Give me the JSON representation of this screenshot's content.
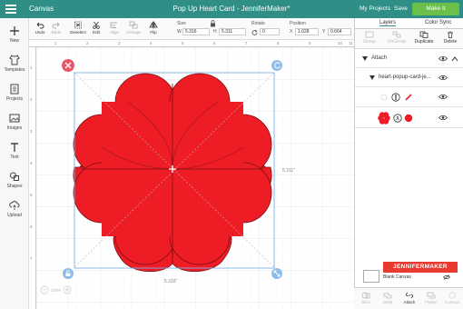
{
  "topbar": {
    "app_name": "Canvas",
    "title": "Pop Up Heart Card - JenniferMaker*",
    "my_projects": "My Projects",
    "save": "Save",
    "make_it": "Make It"
  },
  "sidebar": {
    "items": [
      {
        "label": "New",
        "icon": "plus-icon"
      },
      {
        "label": "Templates",
        "icon": "shirt-icon"
      },
      {
        "label": "Projects",
        "icon": "projects-icon"
      },
      {
        "label": "Images",
        "icon": "image-icon"
      },
      {
        "label": "Text",
        "icon": "text-icon"
      },
      {
        "label": "Shapes",
        "icon": "shapes-icon"
      },
      {
        "label": "Upload",
        "icon": "upload-icon"
      }
    ]
  },
  "toolbar": {
    "undo": "Undo",
    "redo": "Redo",
    "deselect": "Deselect",
    "edit": "Edit",
    "align": "Align",
    "arrange": "Arrange",
    "flip": "Flip",
    "size_label": "Size",
    "w_letter": "W",
    "w_value": "5.316",
    "h_letter": "H",
    "h_value": "5.311",
    "rotate_label": "Rotate",
    "rotate_value": "0",
    "position_label": "Position",
    "x_letter": "X",
    "x_value": "1.028",
    "y_letter": "Y",
    "y_value": "0.664"
  },
  "ruler": {
    "top": [
      "1",
      "2",
      "3",
      "4",
      "5",
      "6",
      "7",
      "8",
      "9",
      "10",
      "11"
    ],
    "left": [
      "1",
      "2",
      "3",
      "4",
      "5",
      "6",
      "7"
    ]
  },
  "canvas": {
    "shape_color": "#ee1c25",
    "width_dim": "5.316\"",
    "height_dim": "5.311\"",
    "zoom": "100%"
  },
  "layers_panel": {
    "tab_layers": "Layers",
    "tab_color_sync": "Color Sync",
    "actions": [
      "Group",
      "UnGroup",
      "Duplicate",
      "Delete"
    ],
    "attach_label": "Attach",
    "group_label": "heart-popup-card-je...",
    "bottom_actions": [
      "Slice",
      "Weld",
      "Attach",
      "Flatten",
      "Contour"
    ],
    "blank_canvas": "Blank Canvas",
    "brand": "JENNIFERMAKER"
  },
  "colors": {
    "topbar": "#2f8f86",
    "make_button": "#6ac04a",
    "brand": "#e83a2e",
    "selection": "#7fb2e5",
    "delete_handle": "#e9566b"
  }
}
